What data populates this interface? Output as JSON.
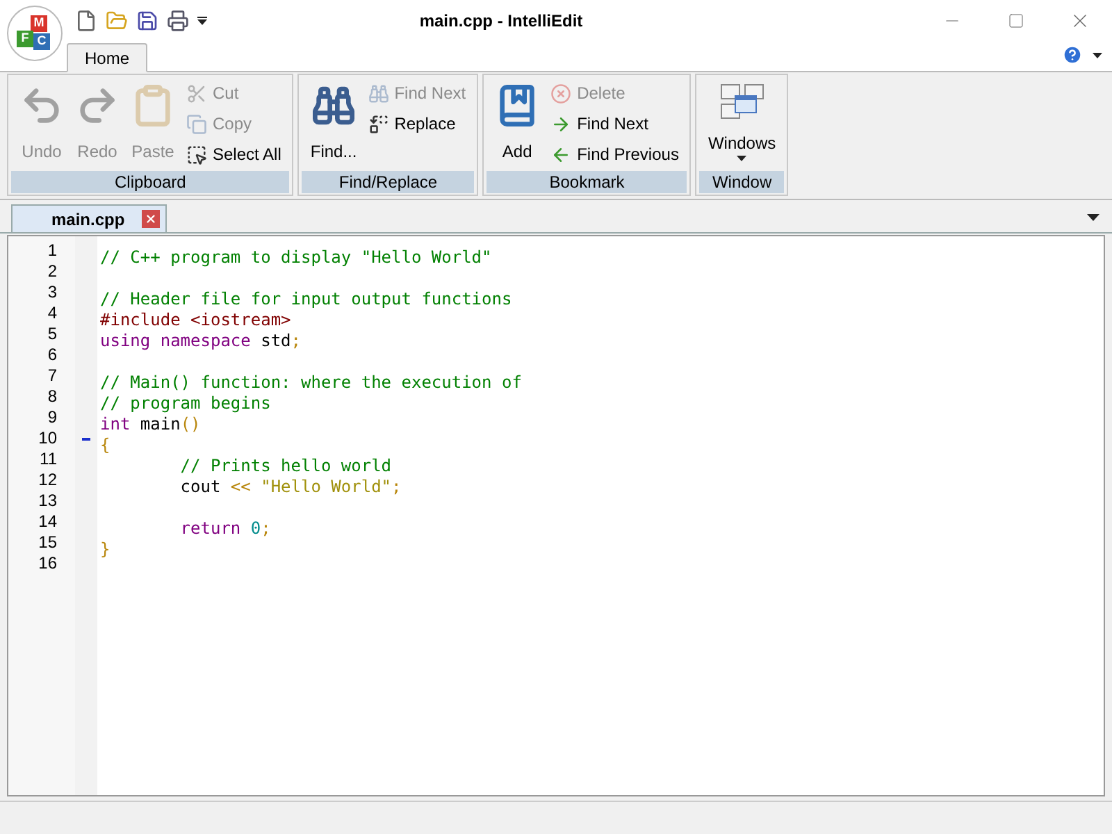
{
  "window": {
    "title": "main.cpp - IntelliEdit"
  },
  "app_button": {
    "letters": [
      "M",
      "F",
      "C"
    ]
  },
  "ribbon_tabs": [
    {
      "label": "Home",
      "selected": true
    }
  ],
  "ribbon_groups": [
    {
      "title": "Clipboard",
      "buttons": [
        {
          "kind": "large",
          "label": "Undo",
          "disabled": true
        },
        {
          "kind": "large",
          "label": "Redo",
          "disabled": true
        },
        {
          "kind": "large",
          "label": "Paste",
          "disabled": true
        },
        {
          "kind": "small",
          "label": "Cut",
          "disabled": true
        },
        {
          "kind": "small",
          "label": "Copy",
          "disabled": true
        },
        {
          "kind": "small",
          "label": "Select All",
          "disabled": false
        }
      ]
    },
    {
      "title": "Find/Replace",
      "buttons": [
        {
          "kind": "large",
          "label": "Find...",
          "disabled": false
        },
        {
          "kind": "small",
          "label": "Find Next",
          "disabled": true
        },
        {
          "kind": "small",
          "label": "Replace",
          "disabled": false
        }
      ]
    },
    {
      "title": "Bookmark",
      "buttons": [
        {
          "kind": "large",
          "label": "Add",
          "disabled": false
        },
        {
          "kind": "small",
          "label": "Delete",
          "disabled": true
        },
        {
          "kind": "small",
          "label": "Find Next",
          "disabled": false
        },
        {
          "kind": "small",
          "label": "Find Previous",
          "disabled": false
        }
      ]
    },
    {
      "title": "Window",
      "buttons": [
        {
          "kind": "dropdown",
          "label": "Windows",
          "disabled": false
        }
      ]
    }
  ],
  "document_tabs": [
    {
      "label": "main.cpp",
      "selected": true
    }
  ],
  "editor": {
    "lines": [
      {
        "number": "1",
        "tokens": [
          {
            "kind": "comment",
            "text": "// C++ program to display \"Hello World\""
          }
        ]
      },
      {
        "number": "2"
      },
      {
        "number": "3",
        "tokens": [
          {
            "kind": "comment",
            "text": "// Header file for input output functions"
          }
        ]
      },
      {
        "number": "4",
        "tokens": [
          {
            "kind": "preprocessor",
            "text": "#include <iostream>"
          }
        ]
      },
      {
        "number": "5",
        "tokens": [
          {
            "kind": "keyword",
            "text": "using namespace"
          },
          {
            "kind": "plain",
            "text": " std"
          },
          {
            "kind": "operator",
            "text": ";"
          }
        ]
      },
      {
        "number": "6"
      },
      {
        "number": "7",
        "tokens": [
          {
            "kind": "comment",
            "text": "// Main() function: where the execution of"
          }
        ]
      },
      {
        "number": "8",
        "tokens": [
          {
            "kind": "comment",
            "text": "// program begins"
          }
        ]
      },
      {
        "number": "9",
        "tokens": [
          {
            "kind": "keyword",
            "text": "int"
          },
          {
            "kind": "plain",
            "text": " main"
          },
          {
            "kind": "operator",
            "text": "()"
          }
        ]
      },
      {
        "number": "10",
        "fold": true,
        "tokens": [
          {
            "kind": "operator",
            "text": "{"
          }
        ]
      },
      {
        "number": "11",
        "tokens": [
          {
            "kind": "comment",
            "text": "        // Prints hello world"
          }
        ]
      },
      {
        "number": "12",
        "tokens": [
          {
            "kind": "plain",
            "text": "        cout "
          },
          {
            "kind": "operator",
            "text": "<< "
          },
          {
            "kind": "string",
            "text": "\"Hello World\""
          },
          {
            "kind": "operator",
            "text": ";"
          }
        ]
      },
      {
        "number": "13"
      },
      {
        "number": "14",
        "tokens": [
          {
            "kind": "keyword",
            "text": "        return "
          },
          {
            "kind": "number",
            "text": "0"
          },
          {
            "kind": "operator",
            "text": ";"
          }
        ]
      },
      {
        "number": "15",
        "tokens": [
          {
            "kind": "operator",
            "text": "}"
          }
        ]
      },
      {
        "number": "16"
      }
    ]
  }
}
